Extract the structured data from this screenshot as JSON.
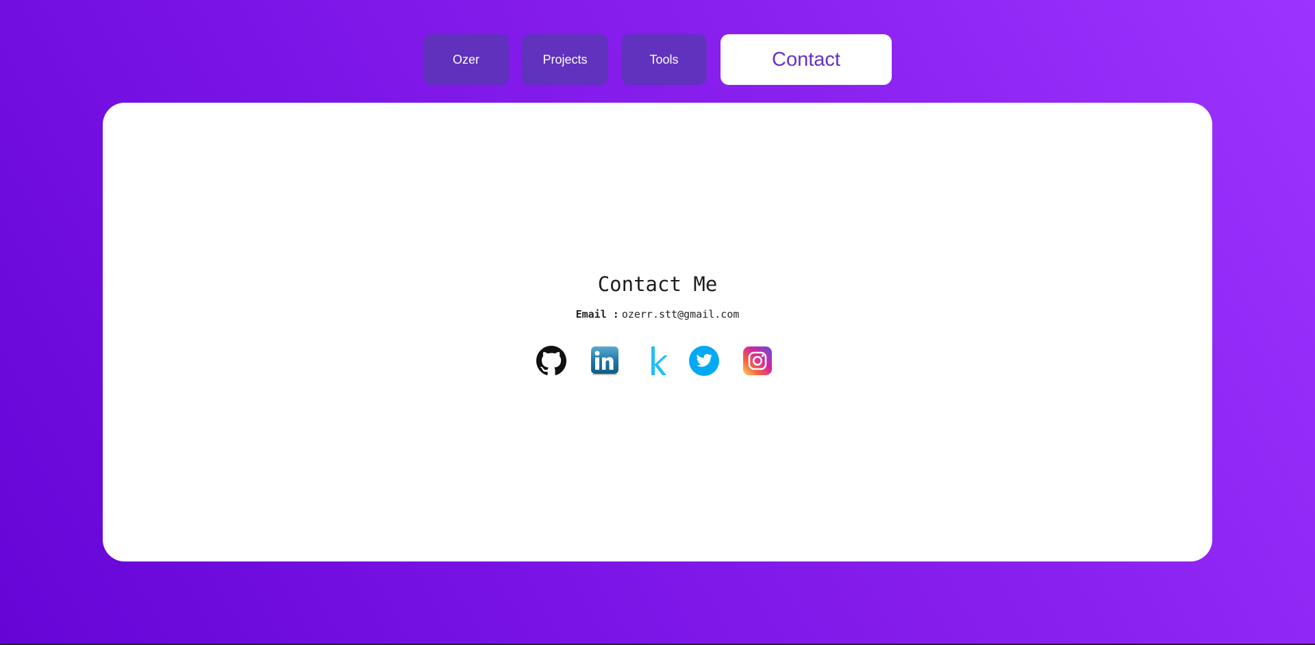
{
  "nav": {
    "items": [
      {
        "label": "Ozer"
      },
      {
        "label": "Projects"
      },
      {
        "label": "Tools"
      },
      {
        "label": "Contact"
      }
    ],
    "active": "Contact"
  },
  "contact": {
    "title": "Contact Me",
    "email_label": "Email :",
    "email_value": "ozerr.stt@gmail.com"
  },
  "socials": [
    {
      "name": "github-icon"
    },
    {
      "name": "linkedin-icon"
    },
    {
      "name": "kaggle-icon"
    },
    {
      "name": "twitter-icon"
    },
    {
      "name": "instagram-icon"
    }
  ],
  "colors": {
    "background_start": "#6405d6",
    "background_end": "#9d33ff",
    "nav_button": "#5638af",
    "active_text": "#6430c8",
    "linkedin": "#1e7aa8",
    "kaggle": "#20beff",
    "twitter": "#03a9f4"
  }
}
